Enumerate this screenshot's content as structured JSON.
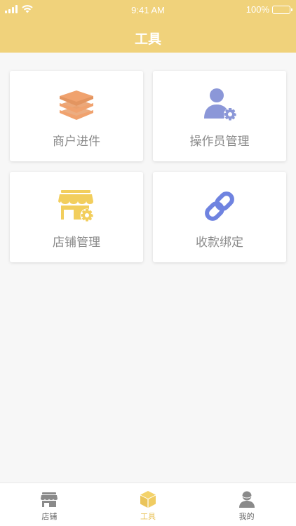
{
  "status_bar": {
    "time": "9:41 AM",
    "battery": "100%"
  },
  "header": {
    "title": "工具"
  },
  "tools": [
    {
      "label": "商户进件",
      "icon": "layers-icon",
      "color": "#f0a26e"
    },
    {
      "label": "操作员管理",
      "icon": "user-gear-icon",
      "color": "#8b97d8"
    },
    {
      "label": "店铺管理",
      "icon": "store-gear-icon",
      "color": "#f2ce5d"
    },
    {
      "label": "收款绑定",
      "icon": "link-icon",
      "color": "#6f83e0"
    }
  ],
  "tabbar": {
    "items": [
      {
        "label": "店铺",
        "icon": "store-icon",
        "active": false
      },
      {
        "label": "工具",
        "icon": "box-icon",
        "active": true
      },
      {
        "label": "我的",
        "icon": "profile-icon",
        "active": false
      }
    ]
  },
  "colors": {
    "accent": "#f0d27b",
    "active_tab": "#e9c35a",
    "inactive_tab": "#8a8a8a"
  }
}
